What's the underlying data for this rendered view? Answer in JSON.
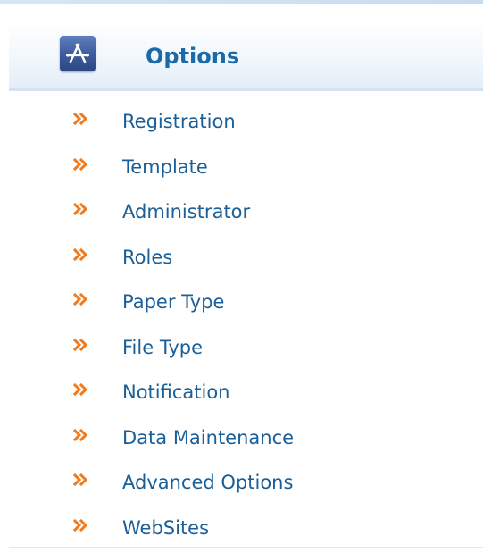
{
  "header": {
    "title": "Options",
    "icon": "app-store-icon"
  },
  "menu": {
    "arrow_icon": "double-chevron-right-icon",
    "arrow_color": "#f07b1d",
    "link_color": "#1b5f98",
    "items": [
      {
        "label": "Registration"
      },
      {
        "label": "Template"
      },
      {
        "label": "Administrator"
      },
      {
        "label": "Roles"
      },
      {
        "label": "Paper Type"
      },
      {
        "label": "File Type"
      },
      {
        "label": "Notification"
      },
      {
        "label": "Data Maintenance"
      },
      {
        "label": "Advanced Options"
      },
      {
        "label": "WebSites"
      }
    ]
  },
  "colors": {
    "title": "#1b6aa8",
    "icon_bg": "#3d5a9c",
    "header_border": "#d2e2f3"
  }
}
